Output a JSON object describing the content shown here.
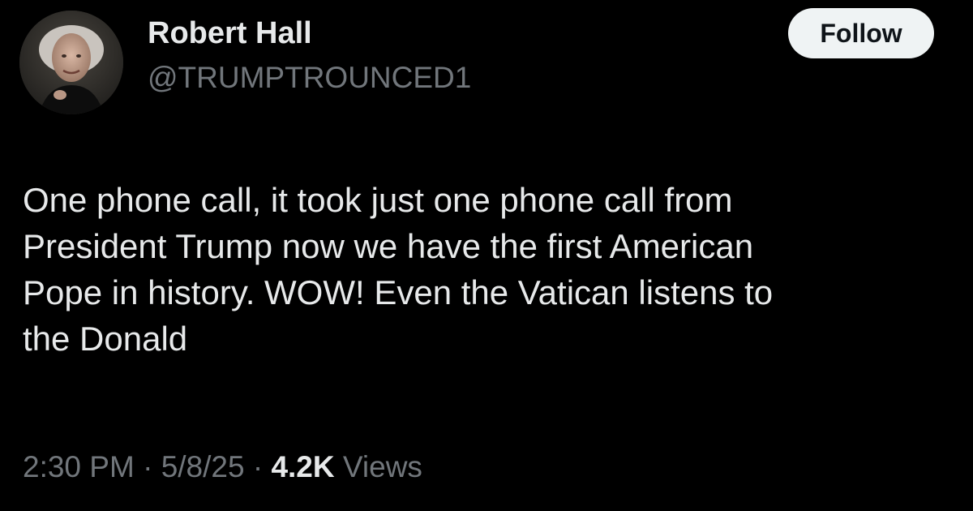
{
  "author": {
    "name": "Robert Hall",
    "handle": "@TRUMPTROUNCED1",
    "avatar_icon": "profile-photo"
  },
  "follow_button": {
    "label": "Follow"
  },
  "tweet": {
    "text": "One phone call, it took just one phone call from\nPresident Trump now we have the first American\nPope in history. WOW! Even the Vatican listens to\nthe Donald"
  },
  "meta": {
    "time": "2:30 PM",
    "separator": "·",
    "date": "5/8/25",
    "views_count": "4.2K",
    "views_label": "Views"
  },
  "colors": {
    "background": "#000000",
    "primary_text": "#e7e9ea",
    "secondary_text": "#71767b",
    "button_bg": "#eff3f4",
    "button_text": "#0f1419"
  }
}
